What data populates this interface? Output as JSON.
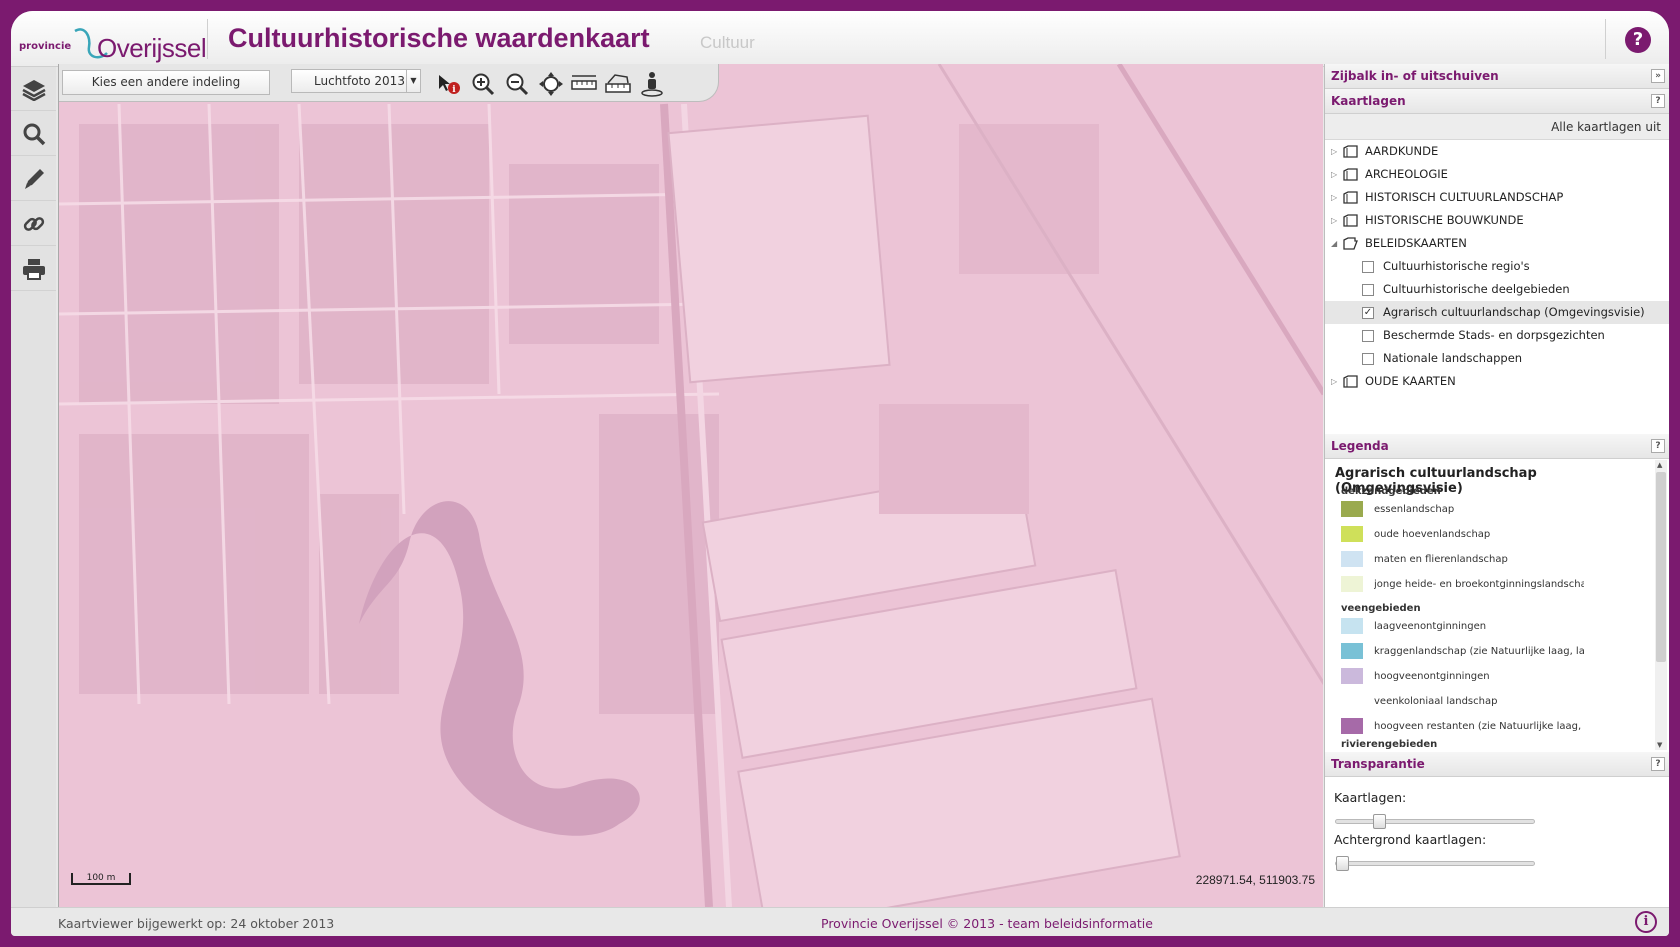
{
  "header": {
    "logo_small": "provincie",
    "logo_name": "Overijssel",
    "title": "Cultuurhistorische waardenkaart",
    "subtitle": "Cultuur",
    "help": "?"
  },
  "left_toolbar": [
    "layers-icon",
    "search-icon",
    "pencil-icon",
    "link-icon",
    "print-icon"
  ],
  "map_toolbar": {
    "indeling_button": "Kies een andere indeling",
    "background_select": "Luchtfoto 2013",
    "tools": [
      "info-icon",
      "zoom-in-icon",
      "zoom-out-icon",
      "pan-icon",
      "measure-distance-icon",
      "measure-area-icon",
      "streetview-icon"
    ]
  },
  "map": {
    "scale": "100 m",
    "coordinates": "228971.54, 511903.75"
  },
  "panel": {
    "sidebar_toggle": "Zijbalk in- of uitschuiven",
    "kaartlagen": {
      "title": "Kaartlagen",
      "all_off": "Alle kaartlagen uit",
      "groups": [
        {
          "label": "AARDKUNDE",
          "expanded": false
        },
        {
          "label": "ARCHEOLOGIE",
          "expanded": false
        },
        {
          "label": "HISTORISCH CULTUURLANDSCHAP",
          "expanded": false
        },
        {
          "label": "HISTORISCHE BOUWKUNDE",
          "expanded": false
        },
        {
          "label": "BELEIDSKAARTEN",
          "expanded": true
        },
        {
          "label": "OUDE KAARTEN",
          "expanded": false
        }
      ],
      "layers": [
        {
          "label": "Cultuurhistorische regio's",
          "checked": false
        },
        {
          "label": "Cultuurhistorische deelgebieden",
          "checked": false
        },
        {
          "label": "Agrarisch cultuurlandschap (Omgevingsvisie)",
          "checked": true
        },
        {
          "label": "Beschermde Stads- en dorpsgezichten",
          "checked": false
        },
        {
          "label": "Nationale landschappen",
          "checked": false
        }
      ]
    },
    "legenda": {
      "title": "Legenda",
      "layer_title": "Agrarisch cultuurlandschap (Omgevingsvisie)",
      "groups": [
        {
          "name": "dekzandgebieden",
          "items": [
            {
              "label": "essenlandschap",
              "color": "#9aaa4e"
            },
            {
              "label": "oude hoevenlandschap",
              "color": "#cfe05a"
            },
            {
              "label": "maten en flierenlandschap",
              "color": "#cfe3f2"
            },
            {
              "label": "jonge heide- en broekontginningslandschap",
              "color": "#eef4d6"
            }
          ]
        },
        {
          "name": "veengebieden",
          "items": [
            {
              "label": "laagveenontginningen",
              "color": "#c6e3f0"
            },
            {
              "label": "kraggenlandschap (zie Natuurlijke laag, la",
              "color": "#79c1d6"
            },
            {
              "label": "hoogveenontginningen",
              "color": "#cbb9dc"
            },
            {
              "label": "veenkoloniaal landschap",
              "color": "#ffffff"
            },
            {
              "label": "hoogveen restanten (zie Natuurlijke laag,",
              "color": "#a66aa8"
            }
          ]
        },
        {
          "name": "rivierengebieden",
          "items": []
        }
      ]
    },
    "transparantie": {
      "title": "Transparantie",
      "kaartlagen_label": "Kaartlagen:",
      "kaartlagen_value": 0.2,
      "achtergrond_label": "Achtergrond kaartlagen:",
      "achtergrond_value": 0
    }
  },
  "footer": {
    "updated": "Kaartviewer bijgewerkt op: 24 oktober 2013",
    "copyright": "Provincie Overijssel © 2013 - team beleidsinformatie",
    "info": "i"
  },
  "colors": {
    "brand": "#7b1a6f",
    "map_overlay": "#ecc4d6"
  }
}
